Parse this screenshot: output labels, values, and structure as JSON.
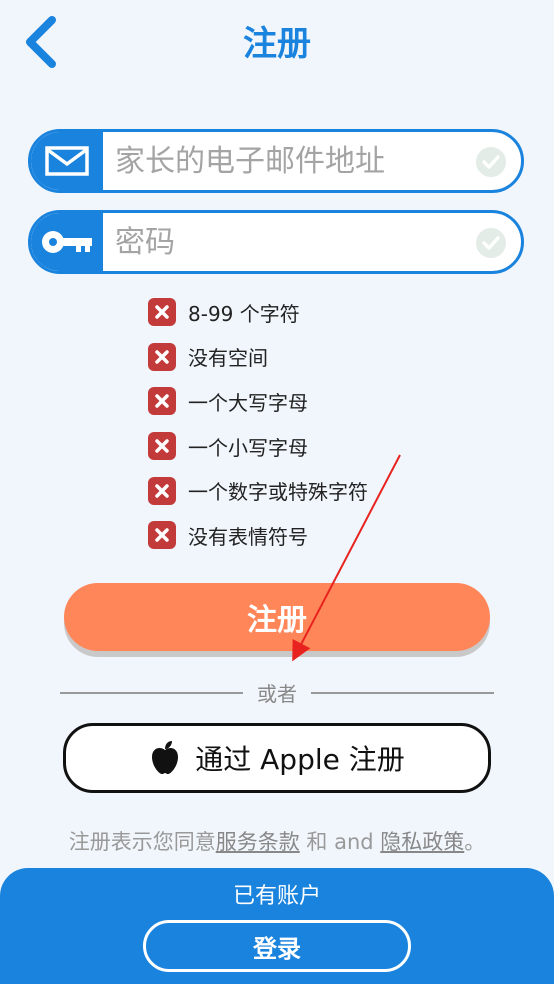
{
  "header": {
    "title": "注册"
  },
  "email": {
    "placeholder": "家长的电子邮件地址",
    "value": ""
  },
  "password": {
    "placeholder": "密码",
    "value": ""
  },
  "password_rules": [
    {
      "label": "8-99 个字符",
      "status": "fail"
    },
    {
      "label": "没有空间",
      "status": "fail"
    },
    {
      "label": "一个大写字母",
      "status": "fail"
    },
    {
      "label": "一个小写字母",
      "status": "fail"
    },
    {
      "label": "一个数字或特殊字符",
      "status": "fail"
    },
    {
      "label": "没有表情符号",
      "status": "fail"
    }
  ],
  "register_button": {
    "label": "注册"
  },
  "divider": {
    "label": "或者"
  },
  "apple_button": {
    "label": "通过 Apple 注册"
  },
  "terms": {
    "prefix": "注册表示您同意",
    "terms_link": "服务条款",
    "middle": " 和 and ",
    "privacy_link": "隐私政策",
    "suffix": "。"
  },
  "footer": {
    "have_account": "已有账户",
    "login_label": "登录"
  },
  "colors": {
    "primary": "#1a83de",
    "register": "#ff8659",
    "rule_fail": "#c23a3a",
    "background": "#f0f6fc"
  }
}
